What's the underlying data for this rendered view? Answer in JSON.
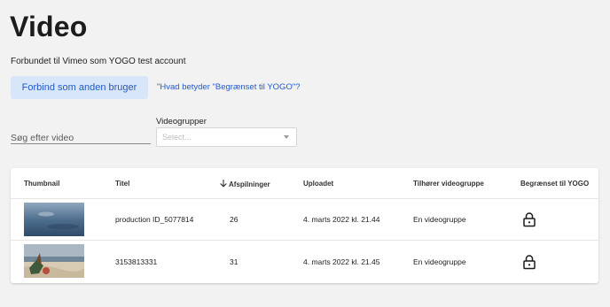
{
  "page": {
    "title": "Video",
    "connected_text": "Forbundet til Vimeo som YOGO test account",
    "connect_button": "Forbind som anden bruger",
    "info_link": "\"Hvad betyder \"Begrænset til YOGO\"?"
  },
  "filters": {
    "search_placeholder": "Søg efter video",
    "group_label": "Videogrupper",
    "group_placeholder": "Select..."
  },
  "table": {
    "columns": {
      "thumbnail": "Thumbnail",
      "title": "Titel",
      "plays": "Afspilninger",
      "uploaded": "Uploadet",
      "group": "Tilhører videogruppe",
      "restricted": "Begrænset til YOGO"
    },
    "sort_icon": "arrow-down-icon",
    "rows": [
      {
        "thumbnail": "video-thumbnail-sea",
        "title": "production ID_5077814",
        "plays": "26",
        "uploaded": "4. marts 2022 kl. 21.44",
        "group": "En videogruppe",
        "restricted_icon": "lock-icon"
      },
      {
        "thumbnail": "video-thumbnail-beach",
        "title": "3153813331",
        "plays": "31",
        "uploaded": "4. marts 2022 kl. 21.45",
        "group": "En videogruppe",
        "restricted_icon": "lock-icon"
      }
    ]
  },
  "colors": {
    "background": "#f2f2f2",
    "accent": "#2458c7",
    "button_bg": "#d8e6fa"
  }
}
